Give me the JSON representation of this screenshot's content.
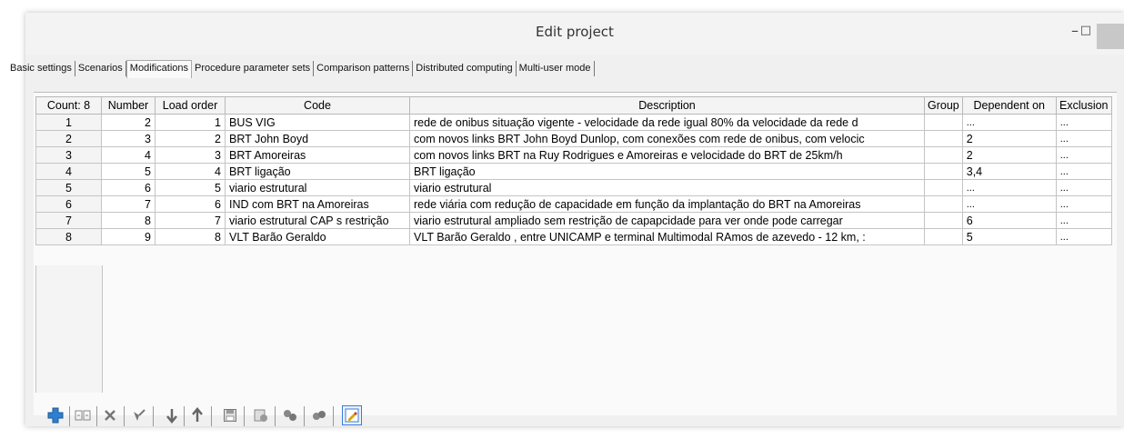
{
  "window": {
    "title": "Edit project",
    "minimize_glyph": "–",
    "restore_glyph": "□"
  },
  "tabs": [
    {
      "label": "Basic settings"
    },
    {
      "label": "Scenarios"
    },
    {
      "label": "Modifications",
      "active": true
    },
    {
      "label": "Procedure parameter sets"
    },
    {
      "label": "Comparison patterns"
    },
    {
      "label": "Distributed computing"
    },
    {
      "label": "Multi-user mode"
    }
  ],
  "table": {
    "headers": [
      "Count: 8",
      "Number",
      "Load order",
      "Code",
      "Description",
      "Group",
      "Dependent on",
      "Exclusion"
    ],
    "rows": [
      {
        "count": "1",
        "number": "2",
        "load_order": "1",
        "code": "BUS VIG",
        "description": "rede de onibus situação vigente - velocidade da rede igual 80% da velocidade da rede d",
        "group": "",
        "dependent_on": "...",
        "exclusion": "..."
      },
      {
        "count": "2",
        "number": "3",
        "load_order": "2",
        "code": "BRT John Boyd",
        "description": "com novos links BRT John Boyd Dunlop, com conexões com rede de onibus, com velocic",
        "group": "",
        "dependent_on": "2",
        "exclusion": "..."
      },
      {
        "count": "3",
        "number": "4",
        "load_order": "3",
        "code": "BRT Amoreiras",
        "description": "com novos links BRT na Ruy Rodrigues e Amoreiras e velocidade do BRT de 25km/h",
        "group": "",
        "dependent_on": "2",
        "exclusion": "..."
      },
      {
        "count": "4",
        "number": "5",
        "load_order": "4",
        "code": "BRT ligação",
        "description": "BRT ligação",
        "group": "",
        "dependent_on": "3,4",
        "exclusion": "..."
      },
      {
        "count": "5",
        "number": "6",
        "load_order": "5",
        "code": "viario estrutural",
        "description": "viario estrutural",
        "group": "",
        "dependent_on": "...",
        "exclusion": "..."
      },
      {
        "count": "6",
        "number": "7",
        "load_order": "6",
        "code": "IND com BRT na Amoreiras",
        "description": "rede viária com redução de capacidade em função da implantação do BRT na Amoreiras",
        "group": "",
        "dependent_on": "...",
        "exclusion": "..."
      },
      {
        "count": "7",
        "number": "8",
        "load_order": "7",
        "code": "viario estrutural CAP s restrição",
        "description": "viario estrutural ampliado sem restrição de capapcidade para ver onde pode carregar",
        "group": "",
        "dependent_on": "6",
        "exclusion": "..."
      },
      {
        "count": "8",
        "number": "9",
        "load_order": "8",
        "code": "VLT Barão Geraldo",
        "description": "VLT Barão Geraldo , entre UNICAMP e terminal Multimodal RAmos de azevedo - 12 km, :",
        "group": "",
        "dependent_on": "5",
        "exclusion": "..."
      }
    ]
  },
  "toolbar": {
    "buttons": [
      {
        "icon": "add-icon"
      },
      {
        "icon": "edit-table-icon"
      },
      {
        "icon": "delete-icon"
      },
      {
        "icon": "brush-icon"
      },
      {
        "icon": "arrow-down-icon"
      },
      {
        "icon": "arrow-up-icon"
      },
      {
        "icon": "save-icon"
      },
      {
        "icon": "apply-icon"
      },
      {
        "icon": "link-icon"
      },
      {
        "icon": "unlink-icon"
      },
      {
        "icon": "edit-icon"
      }
    ]
  },
  "colors": {
    "accent": "#3a7bd5",
    "add_icon": "#2f7fd0"
  }
}
